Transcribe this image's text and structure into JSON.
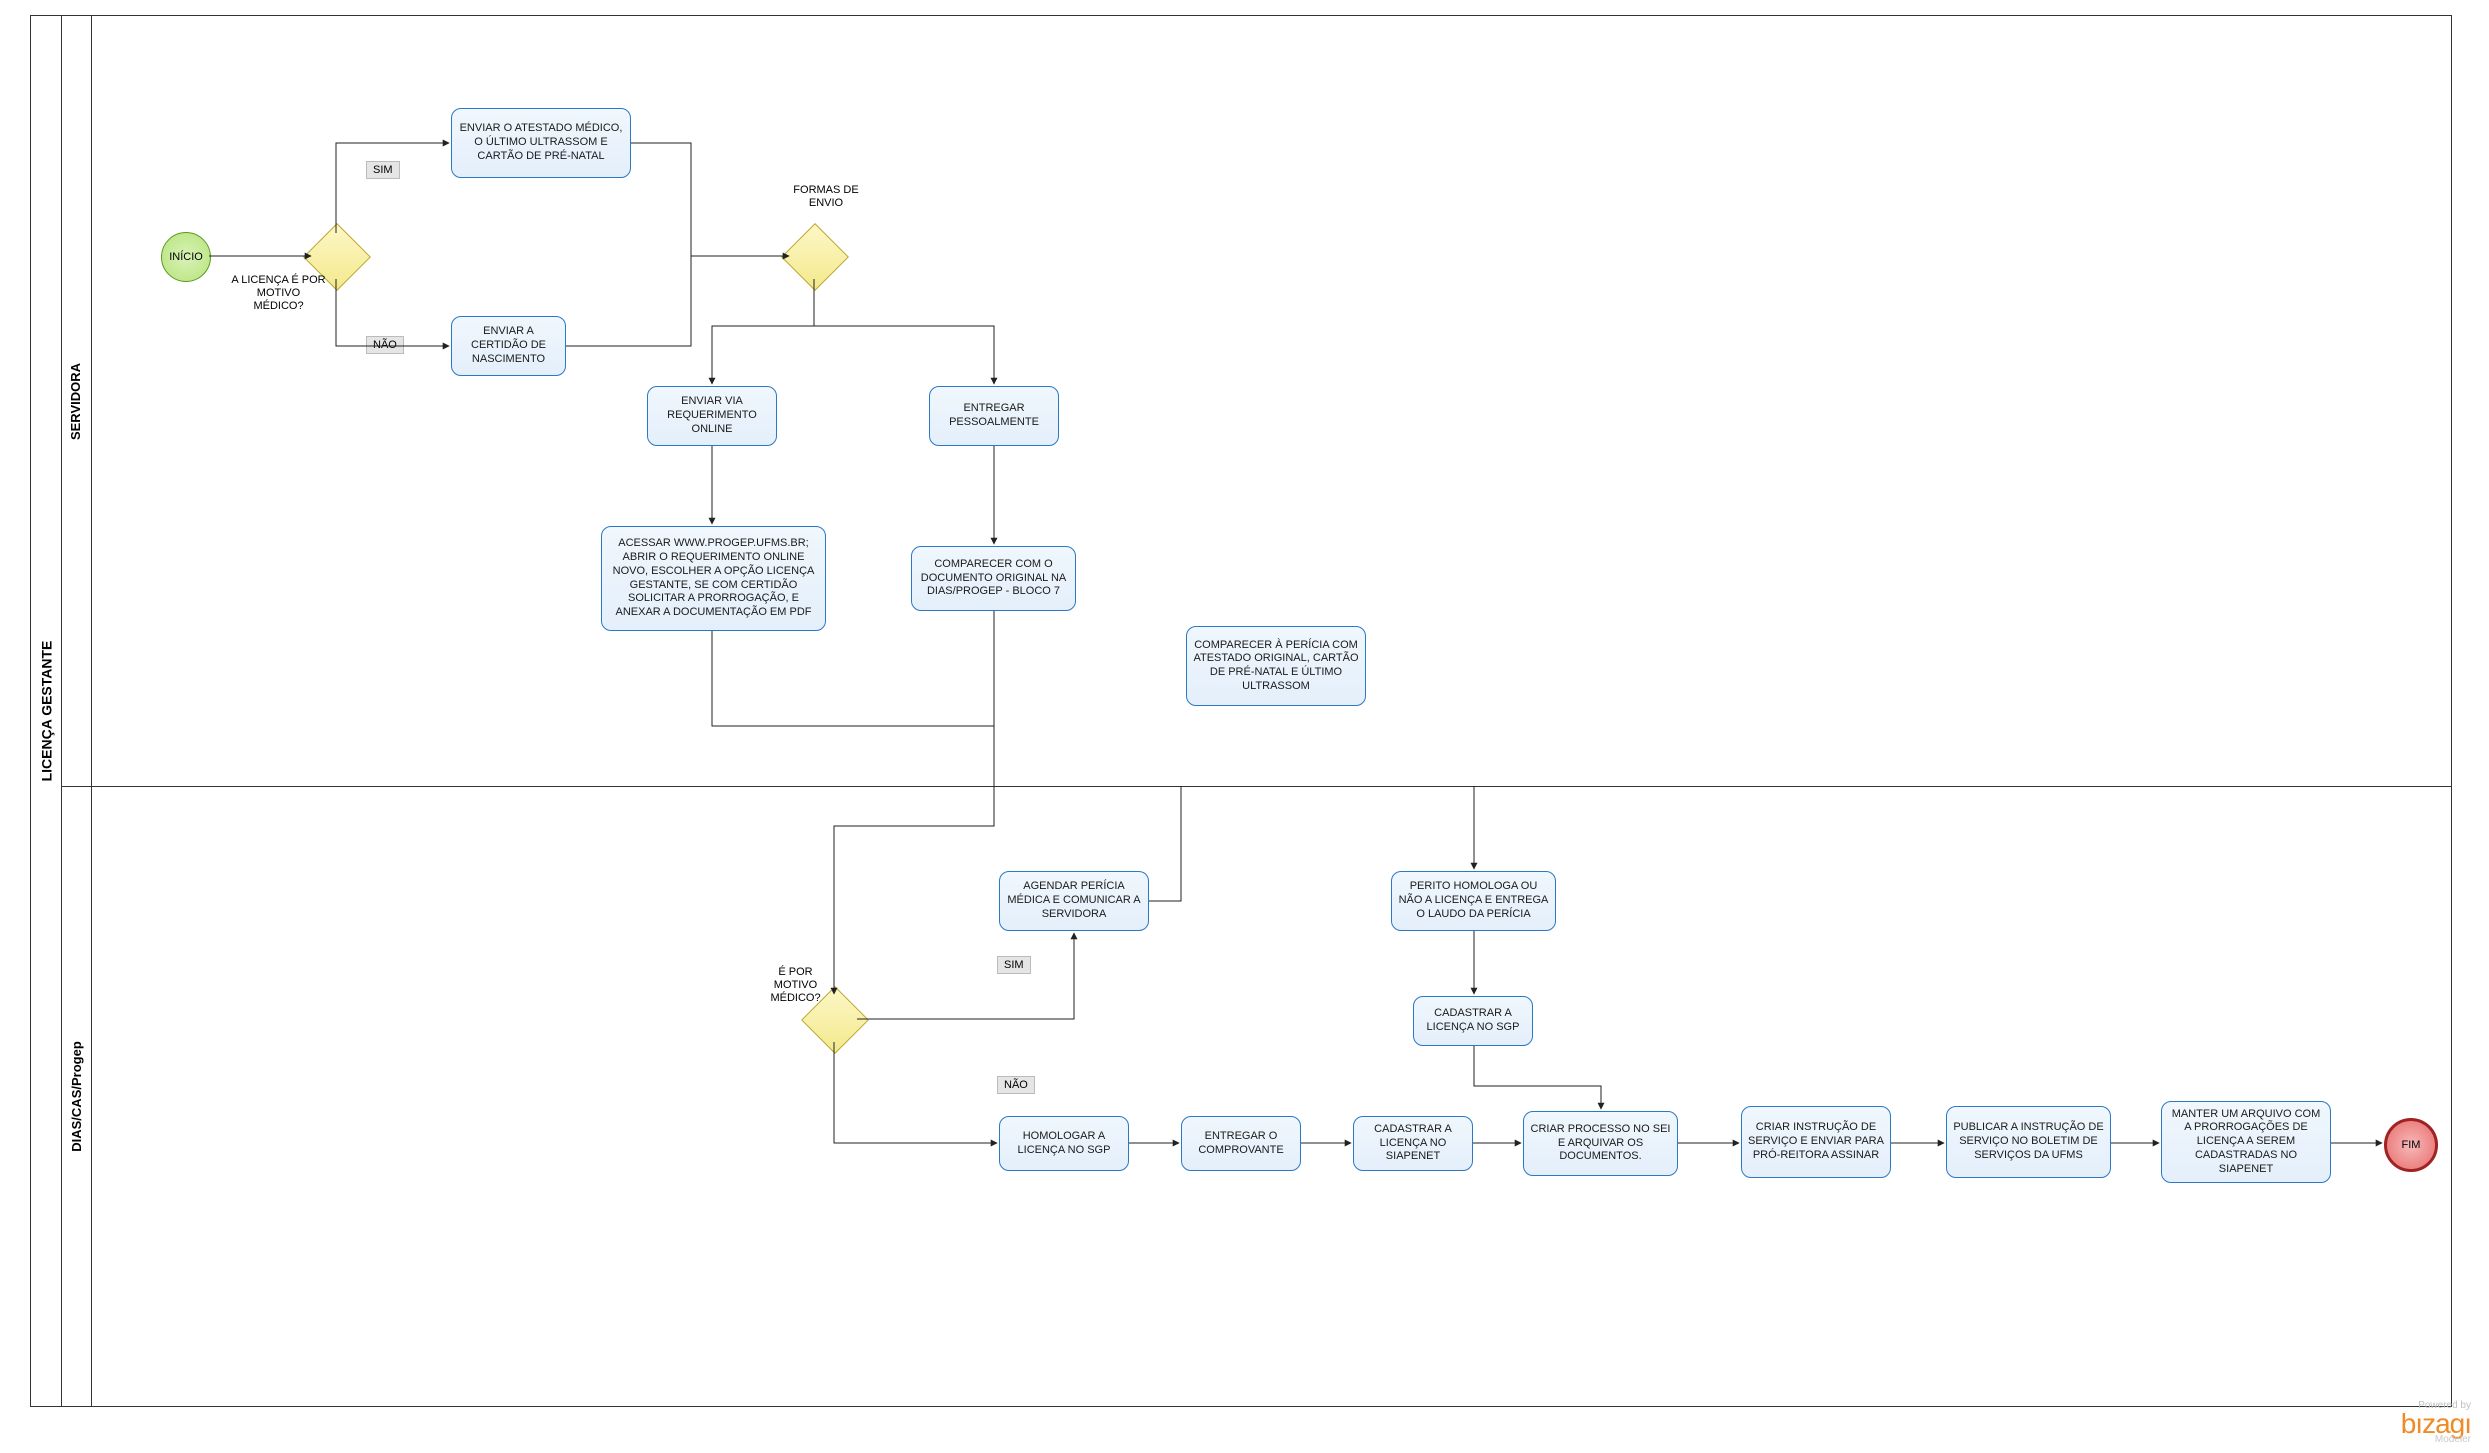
{
  "pool": {
    "title": "LICENÇA GESTANTE"
  },
  "lanes": {
    "servidora": {
      "title": "SERVIDORA"
    },
    "dias": {
      "title": "DIAS/CAS/Progep"
    }
  },
  "events": {
    "start": "INÍCIO",
    "end": "FIM"
  },
  "gateways": {
    "g1_label": "A LICENÇA É POR MOTIVO MÉDICO?",
    "g2_label": "FORMAS DE ENVIO",
    "g3_label": "É POR MOTIVO MÉDICO?"
  },
  "conditions": {
    "sim1": "SIM",
    "nao1": "NÃO",
    "sim2": "SIM",
    "nao2": "NÃO"
  },
  "tasks": {
    "t_enviar_atestado": "ENVIAR  O ATESTADO MÉDICO, O ÚLTIMO ULTRASSOM E CARTÃO DE PRÉ-NATAL",
    "t_enviar_certidao": "ENVIAR A CERTIDÃO DE NASCIMENTO",
    "t_enviar_online": "ENVIAR VIA REQUERIMENTO ONLINE",
    "t_entregar_pess": "ENTREGAR PESSOALMENTE",
    "t_acessar": "ACESSAR WWW.PROGEP.UFMS.BR; ABRIR O REQUERIMENTO ONLINE NOVO, ESCOLHER A OPÇÃO LICENÇA GESTANTE, SE COM CERTIDÃO SOLICITAR A PRORROGAÇÃO, E ANEXAR A DOCUMENTAÇÃO EM PDF",
    "t_comparecer_doc": "COMPARECER COM O DOCUMENTO ORIGINAL NA DIAS/PROGEP - BLOCO 7",
    "t_comparecer_pericia": "COMPARECER À PERÍCIA COM ATESTADO ORIGINAL,  CARTÃO DE PRÉ-NATAL E ÚLTIMO ULTRASSOM",
    "t_agendar": "AGENDAR PERÍCIA MÉDICA E COMUNICAR A SERVIDORA",
    "t_perito": "PERITO HOMOLOGA OU NÃO A LICENÇA E ENTREGA O LAUDO DA PERÍCIA",
    "t_cadastrar_sgp": "CADASTRAR A LICENÇA NO SGP",
    "t_homologar": "HOMOLOGAR A LICENÇA NO SGP",
    "t_entregar_compr": "ENTREGAR O COMPROVANTE",
    "t_cadastrar_siape": "CADASTRAR A LICENÇA NO SIAPENET",
    "t_criar_proc": "CRIAR PROCESSO NO SEI E ARQUIVAR OS DOCUMENTOS.",
    "t_criar_instr": "CRIAR INSTRUÇÃO DE SERVIÇO E ENVIAR PARA PRÓ-REITORA ASSINAR",
    "t_publicar": "PUBLICAR A INSTRUÇÃO DE SERVIÇO NO BOLETIM DE SERVIÇOS DA UFMS",
    "t_manter": "MANTER UM ARQUIVO COM A PRORROGAÇÕES DE LICENÇA A SEREM CADASTRADAS NO SIAPENET"
  },
  "footer": {
    "powered": "Powered by",
    "brand": "bızagı",
    "sub": "Modeler"
  }
}
